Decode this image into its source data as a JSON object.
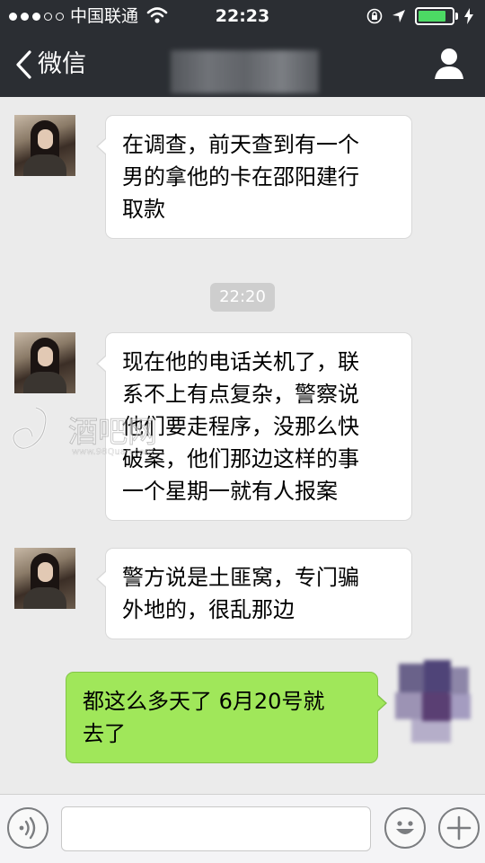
{
  "status_bar": {
    "carrier": "中国联通",
    "time": "22:23",
    "signal_dots_filled": 3,
    "signal_dots_total": 5,
    "battery_level": 0.95,
    "battery_color": "#4cd964"
  },
  "nav_bar": {
    "back_label": "微信",
    "title_obscured": true,
    "icons": {
      "back": "chevron-left-icon",
      "contact": "person-icon"
    }
  },
  "messages": [
    {
      "side": "left",
      "text": "在调查，前天查到有一个\n男的拿他的卡在邵阳建行\n取款"
    },
    {
      "timestamp": "22:20"
    },
    {
      "side": "left",
      "text": "现在他的电话关机了，联\n系不上有点复杂，警察说\n他们要走程序，没那么快\n破案，他们那边这样的事\n一个星期一就有人报案"
    },
    {
      "side": "left",
      "text": "警方说是土匪窝，专门骗\n外地的，很乱那边"
    },
    {
      "side": "right",
      "text": "都这么多天了 6月20号就\n去了"
    }
  ],
  "watermark": {
    "text": "酒吧网",
    "url": "www.98Quan.com"
  },
  "input_bar": {
    "text_value": "",
    "icons": {
      "voice": "voice-icon",
      "emoji": "emoji-icon",
      "more": "plus-icon"
    }
  },
  "colors": {
    "nav_background": "#2b2e33",
    "chat_background": "#ebebeb",
    "incoming_bubble": "#ffffff",
    "outgoing_bubble": "#a0e75a"
  }
}
